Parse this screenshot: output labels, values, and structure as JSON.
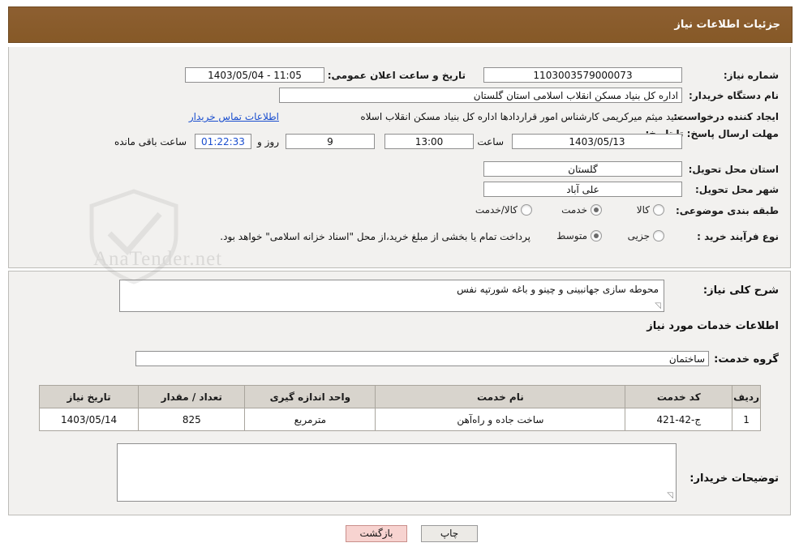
{
  "header": {
    "title": "جزئیات اطلاعات نیاز"
  },
  "watermark": {
    "text": "AnaTender.net"
  },
  "form": {
    "need_number_label": "شماره نیاز:",
    "need_number_value": "1103003579000073",
    "announce_datetime_label": "تاریخ و ساعت اعلان عمومی:",
    "announce_datetime_value": "11:05 - 1403/05/04",
    "buyer_org_label": "نام دستگاه خریدار:",
    "buyer_org_value": "اداره کل بنیاد مسکن انقلاب اسلامی استان گلستان",
    "requester_label": "ایجاد کننده درخواست:",
    "requester_value": "سید میثم میرکریمی کارشناس امور قراردادها اداره کل بنیاد مسکن انقلاب اسلاه",
    "contact_link": "اطلاعات تماس خریدار",
    "deadline_label": "مهلت ارسال پاسخ: تا تاریخ:",
    "deadline_date": "1403/05/13",
    "hour_label": "ساعت",
    "deadline_time": "13:00",
    "days_value": "9",
    "days_label": "روز و",
    "countdown_value": "01:22:33",
    "remaining_label": "ساعت باقی مانده",
    "province_label": "استان محل تحویل:",
    "province_value": "گلستان",
    "city_label": "شهر محل تحویل:",
    "city_value": "علی آباد",
    "category_label": "طبقه بندی موضوعی:",
    "category_options": [
      "کالا",
      "خدمت",
      "کالا/خدمت"
    ],
    "category_selected": "خدمت",
    "process_label": "نوع فرآیند خرید :",
    "process_options": [
      "جزیی",
      "متوسط"
    ],
    "process_selected": "متوسط",
    "process_note": "پرداخت تمام یا بخشی از مبلغ خرید،از محل \"اسناد خزانه اسلامی\" خواهد بود."
  },
  "details": {
    "overview_label": "شرح کلی نیاز:",
    "overview_value": "محوطه سازی جهانبینی و چینو و باغه شورتپه نفس",
    "services_title": "اطلاعات خدمات مورد نیاز",
    "service_group_label": "گروه خدمت:",
    "service_group_value": "ساختمان",
    "buyer_notes_label": "توضیحات خریدار:",
    "buyer_notes_value": ""
  },
  "table": {
    "headers": [
      "ردیف",
      "کد خدمت",
      "نام خدمت",
      "واحد اندازه گیری",
      "تعداد / مقدار",
      "تاریخ نیاز"
    ],
    "rows": [
      {
        "row": "1",
        "code": "ج-42-421",
        "name": "ساخت جاده و راه‌آهن",
        "unit": "مترمربع",
        "qty": "825",
        "date": "1403/05/14"
      }
    ]
  },
  "footer": {
    "print_label": "چاپ",
    "back_label": "بازگشت"
  }
}
